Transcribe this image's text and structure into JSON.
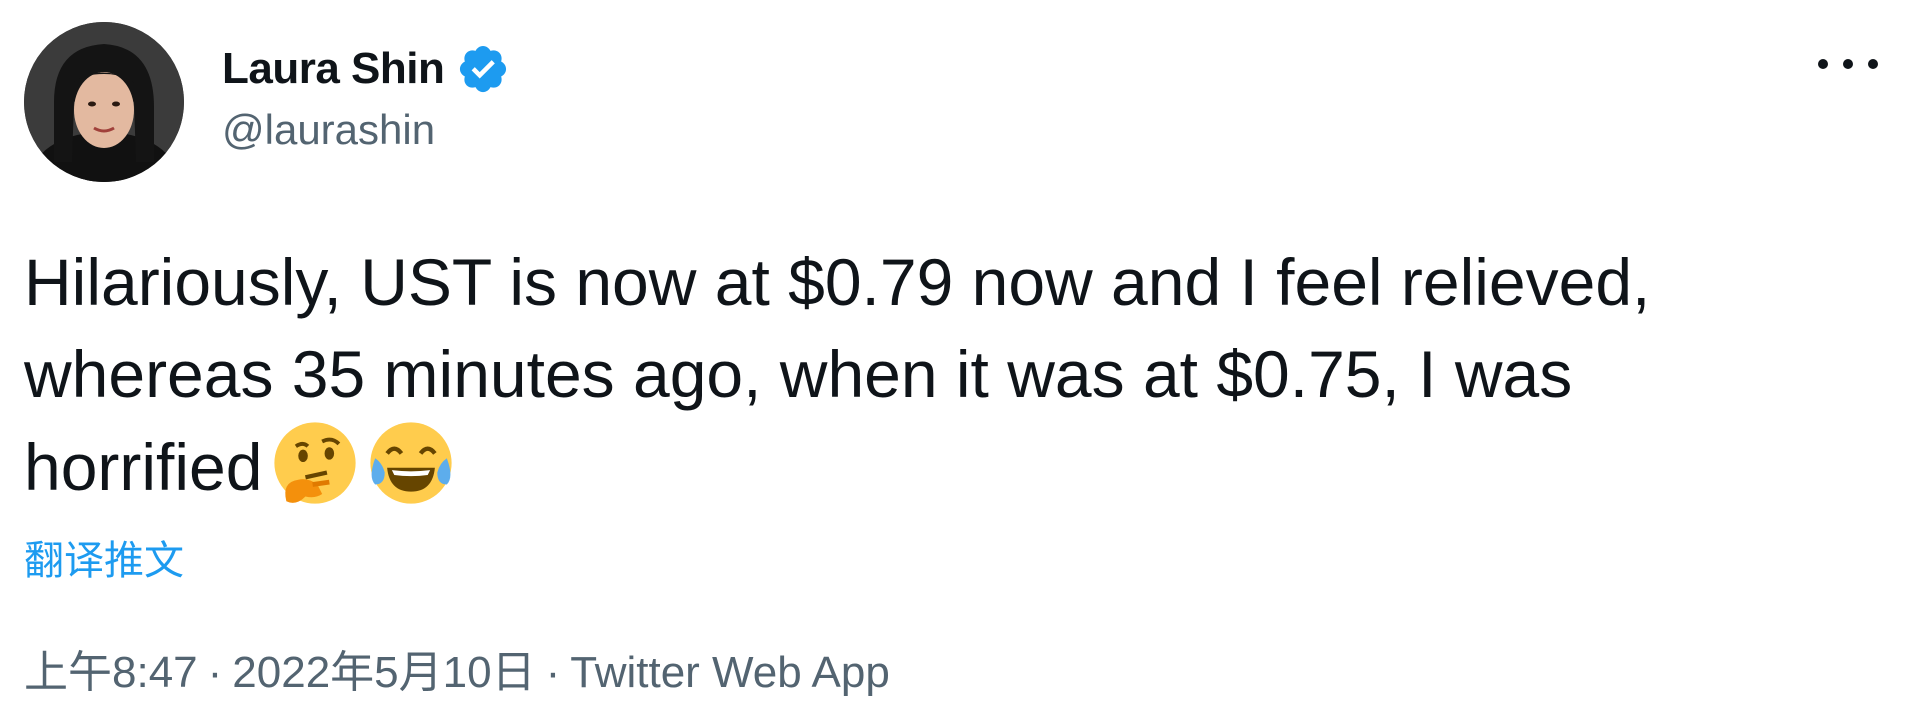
{
  "author": {
    "display_name": "Laura Shin",
    "handle": "@laurashin",
    "verified": true
  },
  "tweet": {
    "text": "Hilariously, UST is now at $0.79 now and I feel relieved, whereas 35 minutes ago, when it was at $0.75, I was horrified",
    "emojis": [
      "thinking-face",
      "face-with-tears-of-joy"
    ],
    "translate_label": "翻译推文",
    "time": "上午8:47",
    "separator": "·",
    "date": "2022年5月10日",
    "source": "Twitter Web App"
  },
  "colors": {
    "accent": "#1d9bf0",
    "text": "#0f1419",
    "secondary": "#536471"
  }
}
